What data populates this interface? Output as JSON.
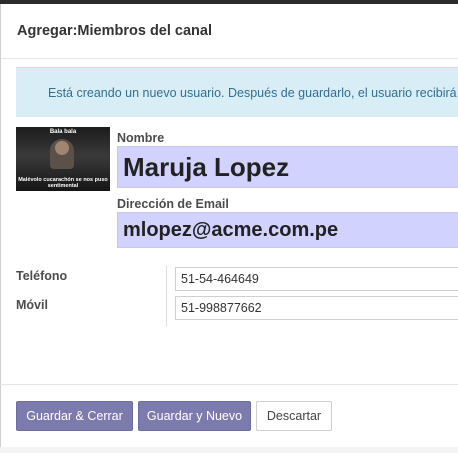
{
  "dialog": {
    "title": "Agregar:Miembros del canal",
    "alert": "Está creando un nuevo usuario. Después de guardarlo, el usuario recibirá",
    "avatar": {
      "top_text": "Bala  bala",
      "bottom_text": "Malévolo cucarachón se nos puso sentimental"
    },
    "form": {
      "name_label": "Nombre",
      "name_value": "Maruja Lopez",
      "email_label": "Dirección de Email",
      "email_value": "mlopez@acme.com.pe",
      "phone_label": "Teléfono",
      "phone_value": "51-54-464649",
      "mobile_label": "Móvil",
      "mobile_value": "51-998877662"
    },
    "buttons": {
      "save_close": "Guardar & Cerrar",
      "save_new": "Guardar y Nuevo",
      "discard": "Descartar"
    }
  },
  "colors": {
    "primary": "#7c7bad",
    "alert_bg": "#d9edf7",
    "alert_text": "#31708f",
    "required_field_bg": "#d2d2ff"
  }
}
